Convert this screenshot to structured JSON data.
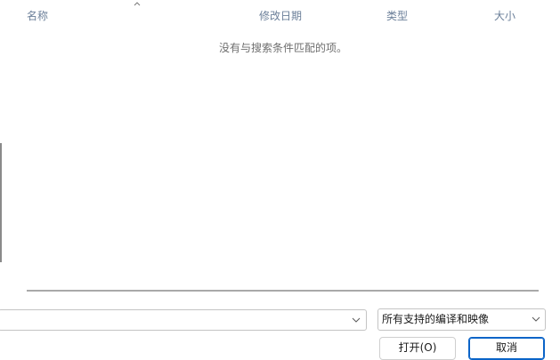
{
  "file_list": {
    "columns": {
      "name": "名称",
      "modified": "修改日期",
      "type": "类型",
      "size": "大小"
    },
    "sort_indicator_icon": "chevron-up-icon",
    "empty_message": "没有与搜索条件匹配的项。"
  },
  "filename_field": {
    "value": "",
    "dropdown_icon": "chevron-down-icon"
  },
  "filetype_select": {
    "selected": "所有支持的编译和映像",
    "dropdown_icon": "chevron-down-icon"
  },
  "buttons": {
    "open": "打开(O)",
    "cancel": "取消"
  },
  "colors": {
    "column_header": "#6b7f99",
    "accent": "#0a64c8",
    "border": "#c4c4c4"
  }
}
